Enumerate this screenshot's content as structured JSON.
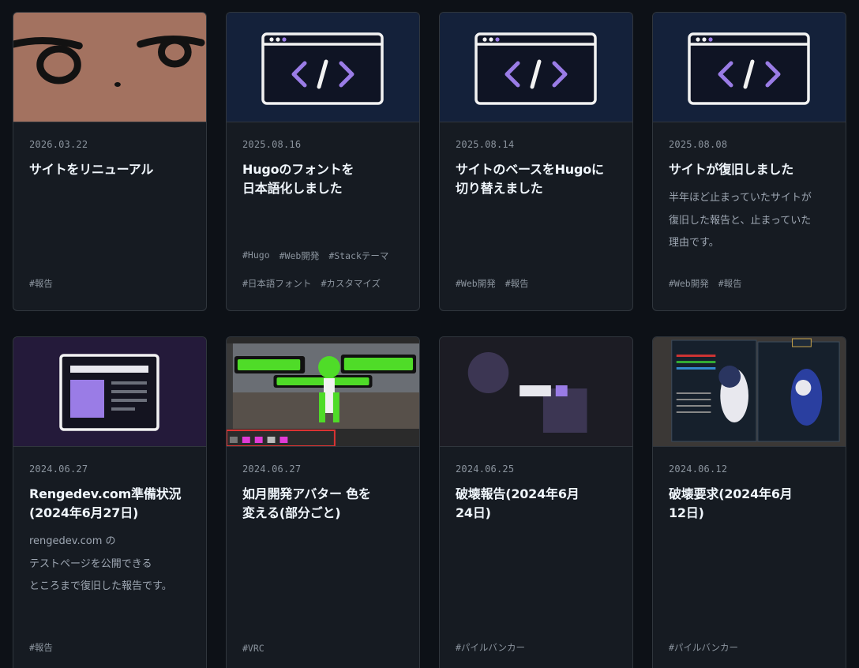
{
  "cards": [
    {
      "date": "2026.03.22",
      "title": "サイトをリニューアル",
      "desc": "",
      "tags": [
        "#報告"
      ],
      "thumb": "photo-face"
    },
    {
      "date": "2025.08.16",
      "title": "Hugoのフォントを\n日本語化しました",
      "desc": "",
      "tags": [
        "#Hugo",
        "#Web開発",
        "#Stackテーマ",
        "#日本語フォント",
        "#カスタマイズ"
      ],
      "thumb": "code-window"
    },
    {
      "date": "2025.08.14",
      "title": "サイトのベースをHugoに\n切り替えました",
      "desc": "",
      "tags": [
        "#Web開発",
        "#報告"
      ],
      "thumb": "code-window"
    },
    {
      "date": "2025.08.08",
      "title": "サイトが復旧しました",
      "desc": "半年ほど止まっていたサイトが\n復旧した報告と、止まっていた\n理由です。",
      "tags": [
        "#Web開発",
        "#報告"
      ],
      "thumb": "code-window"
    },
    {
      "date": "2024.06.27",
      "title": "Rengedev.com準備状況\n(2024年6月27日)",
      "desc": "rengedev.com の\nテストページを公開できる\nところまで復旧した報告です。",
      "tags": [
        "#報告"
      ],
      "thumb": "webpage-layout"
    },
    {
      "date": "2024.06.27",
      "title": "如月開発アバター 色を\n変える(部分ごと)",
      "desc": "",
      "tags": [
        "#VRC"
      ],
      "thumb": "avatar-screenshot"
    },
    {
      "date": "2024.06.25",
      "title": "破壊報告(2024年6月\n24日)",
      "desc": "",
      "tags": [
        "#パイルバンカー"
      ],
      "thumb": "abstract-shapes"
    },
    {
      "date": "2024.06.12",
      "title": "破壊要求(2024年6月\n12日)",
      "desc": "",
      "tags": [
        "#パイルバンカー"
      ],
      "thumb": "game-menu-screenshot"
    }
  ],
  "colors": {
    "background": "#0d1117",
    "card": "#161b22",
    "border": "#30363d",
    "accent": "#9a7ce6"
  }
}
